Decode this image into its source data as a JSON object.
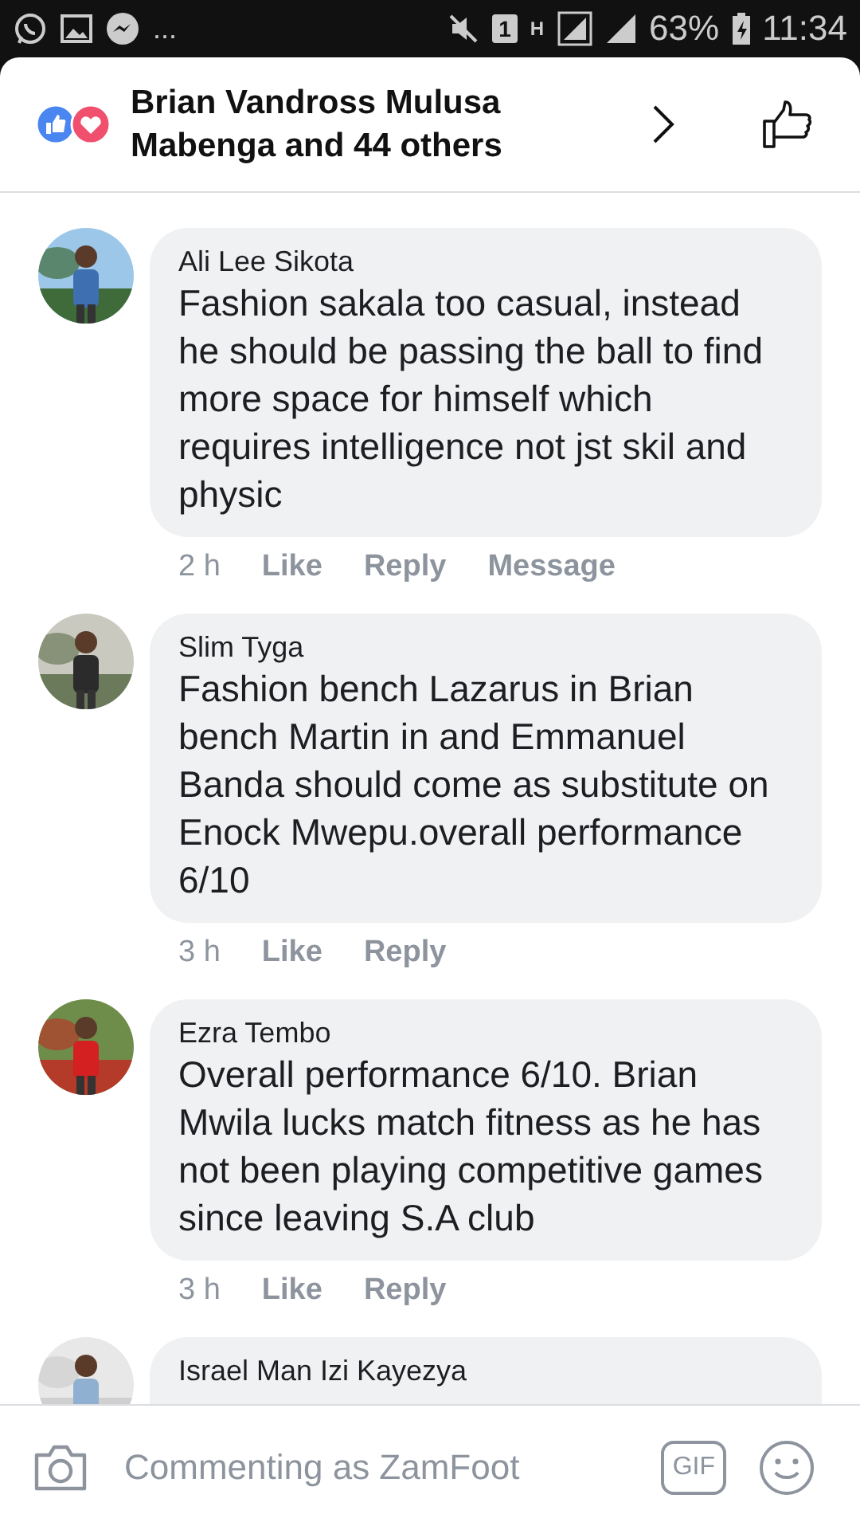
{
  "status_bar": {
    "notification_more": "...",
    "sim_label": "1",
    "network_type": "H",
    "battery": "63%",
    "time": "11:34"
  },
  "header": {
    "reactors": "Brian Vandross Mulusa Mabenga and 44 others"
  },
  "comments": [
    {
      "author": "Ali Lee Sikota",
      "text": "Fashion sakala too casual, instead he should be passing the ball to find more space for himself which requires intelligence not jst skil and physic",
      "time": "2 h",
      "actions": [
        "Like",
        "Reply",
        "Message"
      ],
      "avatar": {
        "kind": "picture"
      }
    },
    {
      "author": "Slim Tyga",
      "text": "Fashion bench Lazarus in Brian bench Martin in and Emmanuel Banda should come as substitute on Enock Mwepu.overall performance 6/10",
      "time": "3 h",
      "actions": [
        "Like",
        "Reply"
      ],
      "avatar": {
        "kind": "picture"
      }
    },
    {
      "author": "Ezra Tembo",
      "text": "Overall performance 6/10. Brian Mwila lucks match fitness as he has not been playing competitive games since leaving S.A club",
      "time": "3 h",
      "actions": [
        "Like",
        "Reply"
      ],
      "avatar": {
        "kind": "picture"
      }
    },
    {
      "author": "Israel Man Izi Kayezya",
      "avatar": {
        "kind": "picture"
      }
    }
  ],
  "composer": {
    "placeholder": "Commenting as ZamFoot",
    "gif_label": "GIF"
  }
}
